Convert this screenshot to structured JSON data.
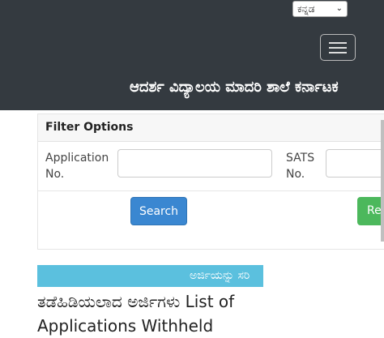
{
  "header": {
    "language_selected": "ಕನ್ನಡ",
    "brand": "ಆದರ್ಶ ವಿದ್ಯಾಲಯ ಮಾದರಿ ಶಾಲೆ ಕರ್ನಾಟಕ"
  },
  "filter": {
    "title": "Filter Options",
    "application_label": "Application No.",
    "sats_label": "SATS No.",
    "search_label": "Search",
    "reset_label": "Res"
  },
  "marquee": {
    "text": "ಅರ್ಜಿಯನ್ನು ಸರಿ"
  },
  "page": {
    "title": "ತಡೆಹಿಡಿಯಲಾದ ಅರ್ಜಿಗಳು List of Applications Withheld"
  },
  "colors": {
    "header_bg": "#343a40",
    "search_btn": "#3a87d1",
    "reset_btn": "#4cb85c",
    "marquee_bg": "#5bc0de"
  },
  "icons": {
    "menu": "hamburger-icon",
    "dropdown": "chevron-down-icon"
  }
}
